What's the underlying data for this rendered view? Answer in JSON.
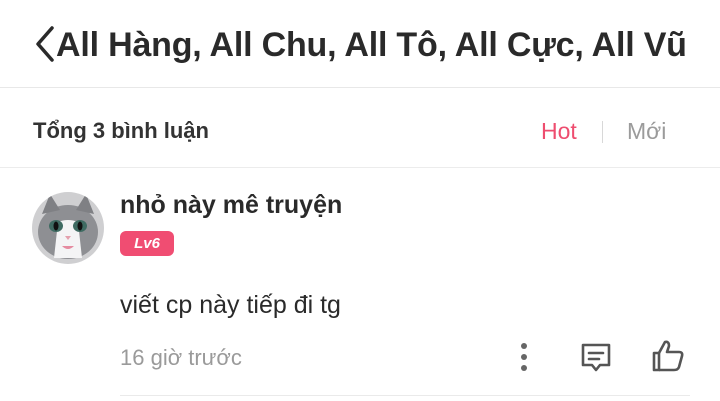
{
  "header": {
    "title": "All Hàng, All Chu, All Tô, All Cực, All Vũ"
  },
  "comments_bar": {
    "total_label": "Tổng 3 bình luận",
    "sort_hot": "Hot",
    "sort_new": "Mới",
    "active_sort": "Hot"
  },
  "comment": {
    "username": "nhỏ này mê truyện",
    "level_badge": "Lv6",
    "text": "viết cp này tiếp đi tg",
    "time": "16 giờ trước"
  },
  "icons": {
    "back": "chevron-left-icon",
    "more": "more-vertical-icon",
    "reply": "comment-icon",
    "like": "thumbs-up-icon"
  },
  "colors": {
    "accent": "#ee4d6f",
    "badge": "#f04d72",
    "muted": "#9a9a9a"
  }
}
